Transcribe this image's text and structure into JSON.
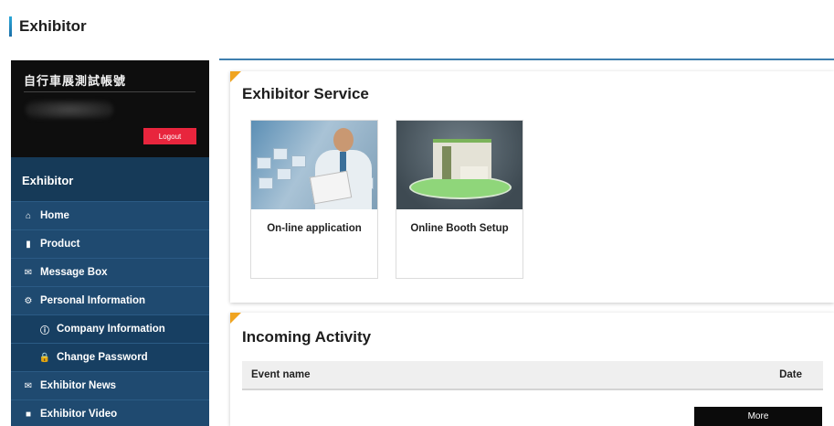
{
  "page": {
    "title": "Exhibitor"
  },
  "account": {
    "name": "自行車展測試帳號",
    "logout_label": "Logout"
  },
  "sidebar": {
    "title": "Exhibitor",
    "items": [
      {
        "label": "Home",
        "icon": "home-icon",
        "glyph": "⌂"
      },
      {
        "label": "Product",
        "icon": "product-icon",
        "glyph": "▮"
      },
      {
        "label": "Message Box",
        "icon": "envelope-icon",
        "glyph": "✉"
      },
      {
        "label": "Personal Information",
        "icon": "gear-icon",
        "glyph": "⚙"
      },
      {
        "label": "Company Information",
        "icon": "info-icon",
        "glyph": "ⓘ"
      },
      {
        "label": "Change Password",
        "icon": "lock-icon",
        "glyph": "🔒"
      },
      {
        "label": "Exhibitor News",
        "icon": "envelope-icon",
        "glyph": "✉"
      },
      {
        "label": "Exhibitor Video",
        "icon": "video-icon",
        "glyph": "■"
      }
    ]
  },
  "services": {
    "title": "Exhibitor Service",
    "cards": [
      {
        "label": "On-line application"
      },
      {
        "label": "Online Booth Setup"
      }
    ]
  },
  "activity": {
    "title": "Incoming Activity",
    "columns": {
      "event": "Event name",
      "date": "Date"
    },
    "more_label": "More"
  },
  "colors": {
    "accent": "#3f7fae",
    "sidebar": "#1f4a70",
    "logout": "#e8253d",
    "corner": "#f0a420"
  }
}
